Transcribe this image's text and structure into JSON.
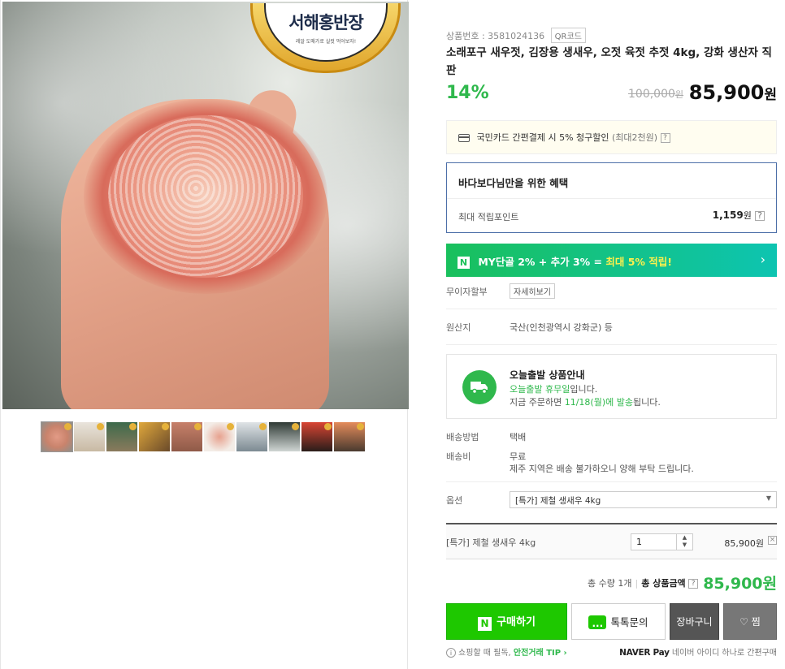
{
  "product": {
    "number_label": "상품번호 : 3581024136",
    "qr_label": "QR코드",
    "title": "소래포구 새우젓, 김장용 생새우, 오젓 육젓 추젓 4kg, 강화 생산자 직판",
    "discount": "14%",
    "original_price": "100,000",
    "original_unit": "원",
    "price": "85,900",
    "price_unit": "원"
  },
  "image": {
    "seal_title": "서해홍반장",
    "seal_sub": "레알 도매가로 실컷 먹어보자!",
    "thumbnail_count": 10
  },
  "card_promo": {
    "text": "국민카드 간편결제 시 5% 청구할인",
    "sub": "(최대2천원)",
    "help": "?"
  },
  "benefit": {
    "title": "바다보다님만을 위한 혜택",
    "row_label": "최대 적립포인트",
    "row_value": "1,159",
    "row_unit": "원",
    "help": "?"
  },
  "npay_banner": {
    "n_badge": "N",
    "text_pre": "MY단골 2% + 추가 3% = ",
    "text_highlight": "최대 5% 적립!",
    "chevron": "›"
  },
  "rows": {
    "installment_label": "무이자할부",
    "installment_btn": "자세히보기",
    "origin_label": "원산지",
    "origin_value": "국산(인천광역시 강화군) 등",
    "method_label": "배송방법",
    "method_value": "택배",
    "fee_label": "배송비",
    "fee_value": "무료",
    "fee_note": "제주 지역은 배송 불가하오니 양해 부탁 드립니다.",
    "option_label": "옵션"
  },
  "shipping": {
    "title": "오늘출발 상품안내",
    "line1_green": "오늘출발 휴무일",
    "line1_rest": "입니다.",
    "line2_pre": "지금 주문하면 ",
    "line2_green": "11/18(월)에 발송",
    "line2_post": "됩니다."
  },
  "option": {
    "selected": "[특가] 제철 생새우 4kg",
    "line_name": "[특가] 제철 생새우 4kg",
    "qty": "1",
    "line_price": "85,900원",
    "remove": "×"
  },
  "total": {
    "qty_text": "총 수량 1개",
    "label": "총 상품금액",
    "help": "?",
    "amount": "85,900원"
  },
  "buttons": {
    "buy": "구매하기",
    "buy_badge": "N",
    "talk": "톡톡문의",
    "cart": "장바구니",
    "wish": "찜"
  },
  "footer": {
    "tip_pre": "쇼핑할 때 필독, ",
    "tip_link": "안전거래 TIP ›",
    "npay_brand": "NAVER Pay",
    "npay_text": "네이버 아이디 하나로 간편구매"
  },
  "colors": {
    "green": "#2fb84c",
    "buy_green": "#1ec800",
    "benefit_border": "#4d6fa8"
  }
}
